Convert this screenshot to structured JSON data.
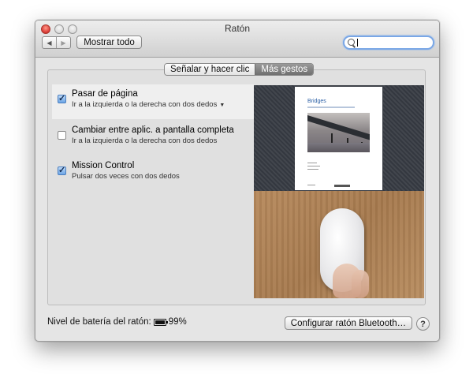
{
  "window": {
    "title": "Ratón"
  },
  "toolbar": {
    "back_icon": "back-arrow-icon",
    "forward_icon": "forward-arrow-icon",
    "show_all_label": "Mostrar todo",
    "search_value": "",
    "search_icon": "search-icon"
  },
  "tabs": [
    {
      "label": "Señalar y hacer clic",
      "active": false
    },
    {
      "label": "Más gestos",
      "active": true
    }
  ],
  "gestures": [
    {
      "title": "Pasar de página",
      "description": "Ir a la izquierda o la derecha con dos dedos",
      "checked": true,
      "has_dropdown": true,
      "selected": true
    },
    {
      "title": "Cambiar entre aplic. a pantalla completa",
      "description": "Ir a la izquierda o la derecha con dos dedos",
      "checked": false,
      "has_dropdown": false,
      "selected": false
    },
    {
      "title": "Mission Control",
      "description": "Pulsar dos veces con dos dedos",
      "checked": true,
      "has_dropdown": false,
      "selected": false
    }
  ],
  "preview": {
    "document_heading": "Bridges"
  },
  "footer": {
    "battery_label": "Nivel de batería del ratón:",
    "battery_icon": "battery-icon",
    "battery_value": "99%",
    "bluetooth_button": "Configurar ratón Bluetooth…",
    "help_label": "?"
  },
  "colors": {
    "accent": "#6da6e6",
    "window_bg": "#e5e5e5",
    "active_tab": "#7d7d7d"
  }
}
